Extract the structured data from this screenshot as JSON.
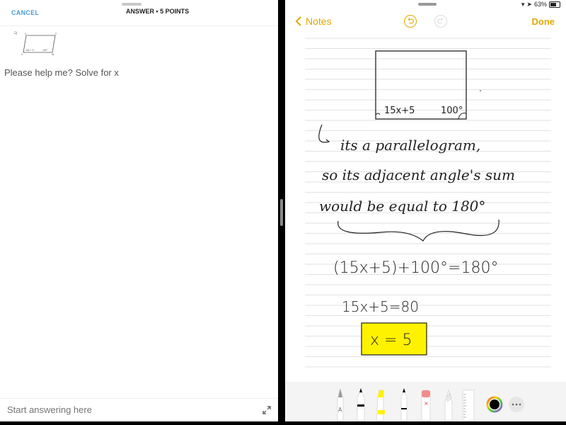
{
  "left_panel": {
    "cancel_label": "CANCEL",
    "title": "ANSWER • 5 POINTS",
    "question_number": "5)",
    "diagram_labels": {
      "angle_left": "15x + 5",
      "angle_right": "100°",
      "v1": "V",
      "v2": "Z",
      "v3": "X",
      "v4": "W"
    },
    "question_text": "Please help me? Solve for x",
    "answer_placeholder": "Start answering here"
  },
  "right_panel": {
    "status": {
      "battery": "63%",
      "battery_level": 0.63
    },
    "back_label": "Notes",
    "done_label": "Done",
    "handwriting": {
      "diagram_left_angle": "15x+5",
      "diagram_right_angle": "100°",
      "line1": "its a parallelogram,",
      "line2": "so its adjacent angle's sum",
      "line3": "would be equal to 180°",
      "equation1": "(15x+5)+100°=180°",
      "equation2": "15x+5=80",
      "answer": "x = 5"
    },
    "colors": {
      "accent": "#e0a800",
      "highlight": "#fff200"
    },
    "tools": [
      "pen",
      "marker",
      "highlighter",
      "fineliner",
      "eraser",
      "pencil",
      "ruler",
      "color-picker",
      "more"
    ]
  }
}
